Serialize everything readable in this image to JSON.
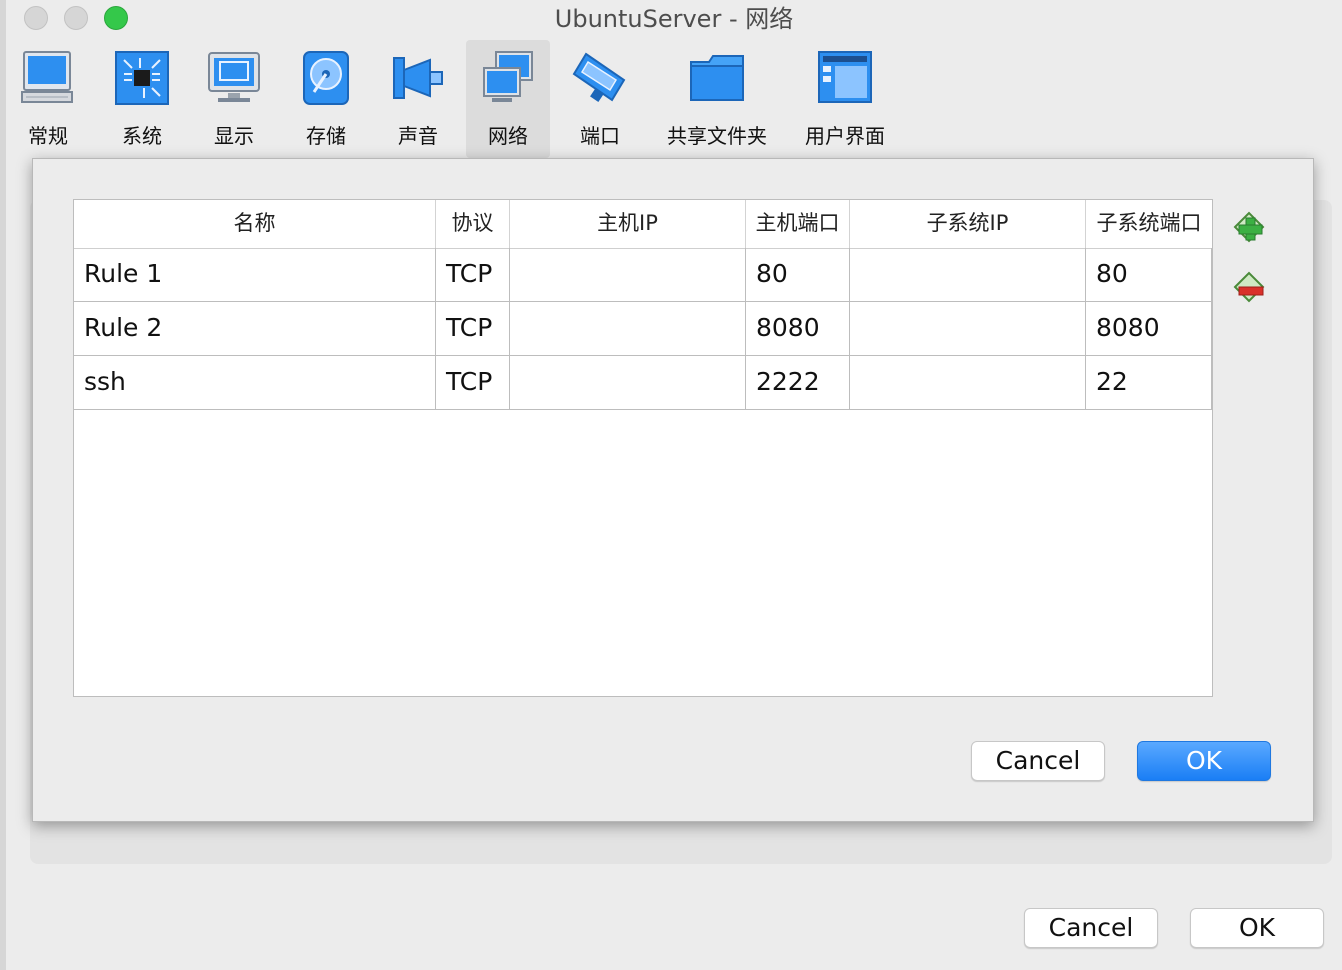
{
  "window": {
    "title": "UbuntuServer - 网络"
  },
  "toolbar": {
    "items": [
      {
        "label": "常规",
        "icon": "computer-icon"
      },
      {
        "label": "系统",
        "icon": "chip-icon"
      },
      {
        "label": "显示",
        "icon": "monitor-icon"
      },
      {
        "label": "存储",
        "icon": "disk-icon"
      },
      {
        "label": "声音",
        "icon": "speaker-icon"
      },
      {
        "label": "网络",
        "icon": "network-icon",
        "selected": true
      },
      {
        "label": "端口",
        "icon": "serial-port-icon"
      },
      {
        "label": "共享文件夹",
        "icon": "folder-icon"
      },
      {
        "label": "用户界面",
        "icon": "user-interface-icon"
      }
    ]
  },
  "port_forwarding": {
    "columns": [
      "名称",
      "协议",
      "主机IP",
      "主机端口",
      "子系统IP",
      "子系统端口"
    ],
    "rows": [
      [
        "Rule 1",
        "TCP",
        "",
        "80",
        "",
        "80"
      ],
      [
        "Rule 2",
        "TCP",
        "",
        "8080",
        "",
        "8080"
      ],
      [
        "ssh",
        "TCP",
        "",
        "2222",
        "",
        "22"
      ]
    ],
    "add_icon": "add-rule-icon",
    "remove_icon": "remove-rule-icon",
    "cancel_label": "Cancel",
    "ok_label": "OK"
  },
  "footer": {
    "cancel_label": "Cancel",
    "ok_label": "OK"
  },
  "colors": {
    "accent": "#1a7ef5",
    "zoom_button": "#34c84a",
    "add_green": "#3cb043",
    "remove_red": "#d9302a"
  }
}
